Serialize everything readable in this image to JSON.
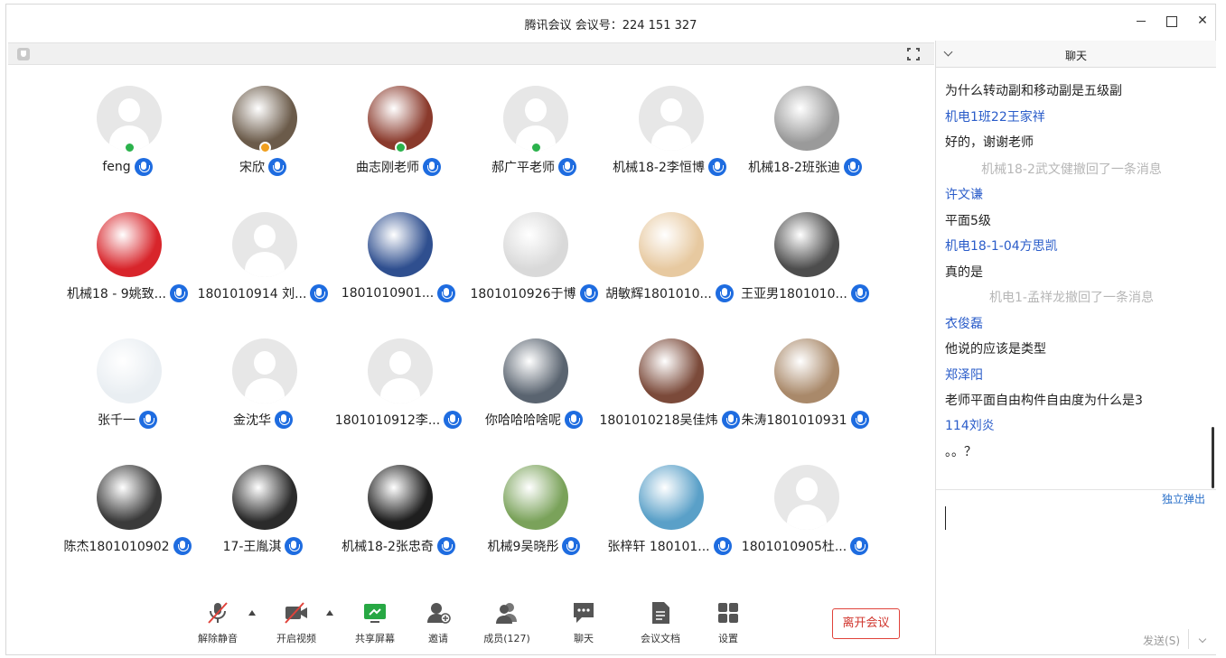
{
  "window": {
    "title": "腾讯会议 会议号：224 151 327"
  },
  "participants": [
    {
      "name": "feng",
      "avatar": "default",
      "badge": "#2bb24c"
    },
    {
      "name": "宋欣",
      "avatar": "photo",
      "color": "#6b5b4a",
      "badge": "#f0a020"
    },
    {
      "name": "曲志刚老师",
      "avatar": "photo",
      "color": "#8a3a2c",
      "badge": "#2bb24c"
    },
    {
      "name": "郝广平老师",
      "avatar": "default",
      "badge": "#2bb24c"
    },
    {
      "name": "机械18-2李恒博",
      "avatar": "default"
    },
    {
      "name": "机械18-2班张迪",
      "avatar": "photo",
      "color": "#9a9a9a"
    },
    {
      "name": "机械18 - 9姚致...",
      "avatar": "photo",
      "color": "#d8252b"
    },
    {
      "name": "1801010914 刘...",
      "avatar": "default"
    },
    {
      "name": "1801010901...",
      "avatar": "photo",
      "color": "#2f4f8f"
    },
    {
      "name": "1801010926于博",
      "avatar": "photo",
      "color": "#d9d9d9"
    },
    {
      "name": "胡敏辉1801010...",
      "avatar": "photo",
      "color": "#e7c9a0"
    },
    {
      "name": "王亚男1801010...",
      "avatar": "photo",
      "color": "#4d4d4d"
    },
    {
      "name": "张千一",
      "avatar": "photo",
      "color": "#e9eef2"
    },
    {
      "name": "金沈华",
      "avatar": "default"
    },
    {
      "name": "1801010912李...",
      "avatar": "default"
    },
    {
      "name": "你哈哈哈啥呢",
      "avatar": "photo",
      "color": "#5a6470"
    },
    {
      "name": "1801010218吴佳炜",
      "avatar": "photo",
      "color": "#7b4a3a"
    },
    {
      "name": "朱涛1801010931",
      "avatar": "photo",
      "color": "#a9896a"
    },
    {
      "name": "陈杰1801010902",
      "avatar": "photo",
      "color": "#3a3a3a"
    },
    {
      "name": "17-王胤淇",
      "avatar": "photo",
      "color": "#2b2b2b"
    },
    {
      "name": "机械18-2张忠奇",
      "avatar": "photo",
      "color": "#1f1f1f"
    },
    {
      "name": "机械9吴晓彤",
      "avatar": "photo",
      "color": "#7aa25a"
    },
    {
      "name": "张梓轩 180101...",
      "avatar": "photo",
      "color": "#5aa0c8"
    },
    {
      "name": "1801010905杜...",
      "avatar": "default"
    }
  ],
  "toolbar": {
    "mute": "解除静音",
    "video": "开启视频",
    "share": "共享屏幕",
    "invite": "邀请",
    "members": "成员(127)",
    "chat": "聊天",
    "docs": "会议文档",
    "settings": "设置",
    "leave": "离开会议"
  },
  "chat": {
    "title": "聊天",
    "messages": [
      {
        "kind": "text",
        "value": "为什么转动副和移动副是五级副"
      },
      {
        "kind": "sender",
        "value": "机电1班22王家祥"
      },
      {
        "kind": "text",
        "value": "好的，谢谢老师"
      },
      {
        "kind": "sys",
        "value": "机械18-2武文健撤回了一条消息"
      },
      {
        "kind": "sender",
        "value": "许文谦"
      },
      {
        "kind": "text",
        "value": "平面5级"
      },
      {
        "kind": "sender",
        "value": "机电18-1-04方思凯"
      },
      {
        "kind": "text",
        "value": "真的是"
      },
      {
        "kind": "sys",
        "value": "机电1-孟祥龙撤回了一条消息"
      },
      {
        "kind": "sender",
        "value": "衣俊磊"
      },
      {
        "kind": "text",
        "value": "他说的应该是类型"
      },
      {
        "kind": "sender",
        "value": "郑泽阳"
      },
      {
        "kind": "text",
        "value": "老师平面自由构件自由度为什么是3"
      },
      {
        "kind": "sender",
        "value": "114刘炎"
      },
      {
        "kind": "text",
        "value": "。。？"
      }
    ],
    "popout": "独立弹出",
    "send": "发送(S)"
  }
}
